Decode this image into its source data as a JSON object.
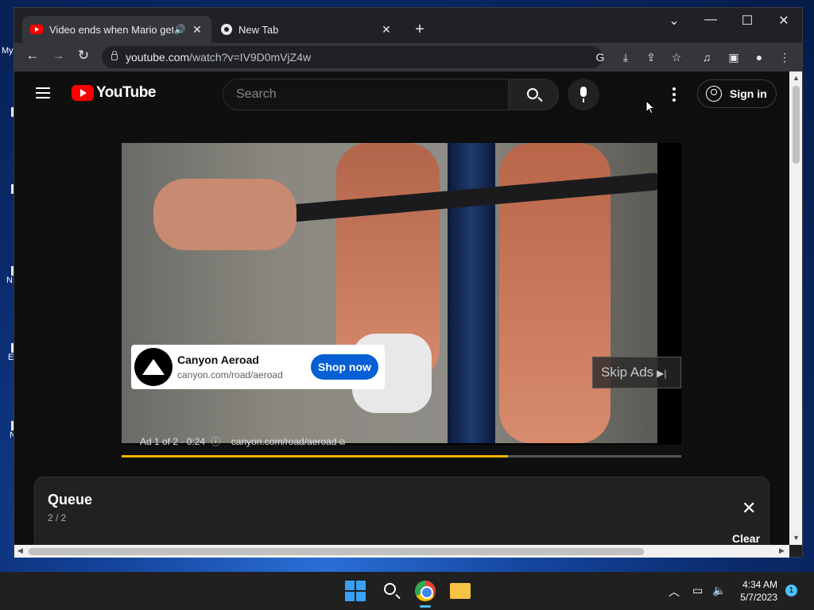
{
  "desktop": {
    "icon_labels": [
      "My",
      "N",
      "E",
      "N"
    ]
  },
  "browser": {
    "tabs": [
      {
        "title": "Video ends when Mario gets",
        "favicon": "youtube-icon",
        "active": true,
        "audio": true
      },
      {
        "title": "New Tab",
        "favicon": "chrome-icon",
        "active": false
      }
    ],
    "url_host": "youtube.com",
    "url_path": "/watch?v=IV9D0mVjZ4w"
  },
  "youtube": {
    "logo_text": "YouTube",
    "search_placeholder": "Search",
    "sign_in_label": "Sign in"
  },
  "ad": {
    "advertiser": "Canyon Aeroad",
    "url": "canyon.com/road/aeroad",
    "cta": "Shop now",
    "skip_label": "Skip Ads",
    "info": "Ad 1 of 2 · 0:24",
    "info_url": "canyon.com/road/aeroad",
    "progress": 0.69,
    "progress_color": "#f0b400"
  },
  "queue": {
    "title": "Queue",
    "count": "2 / 2",
    "clear_label": "Clear"
  },
  "taskbar": {
    "time": "4:34 AM",
    "date": "5/7/2023",
    "notifications": "1"
  }
}
